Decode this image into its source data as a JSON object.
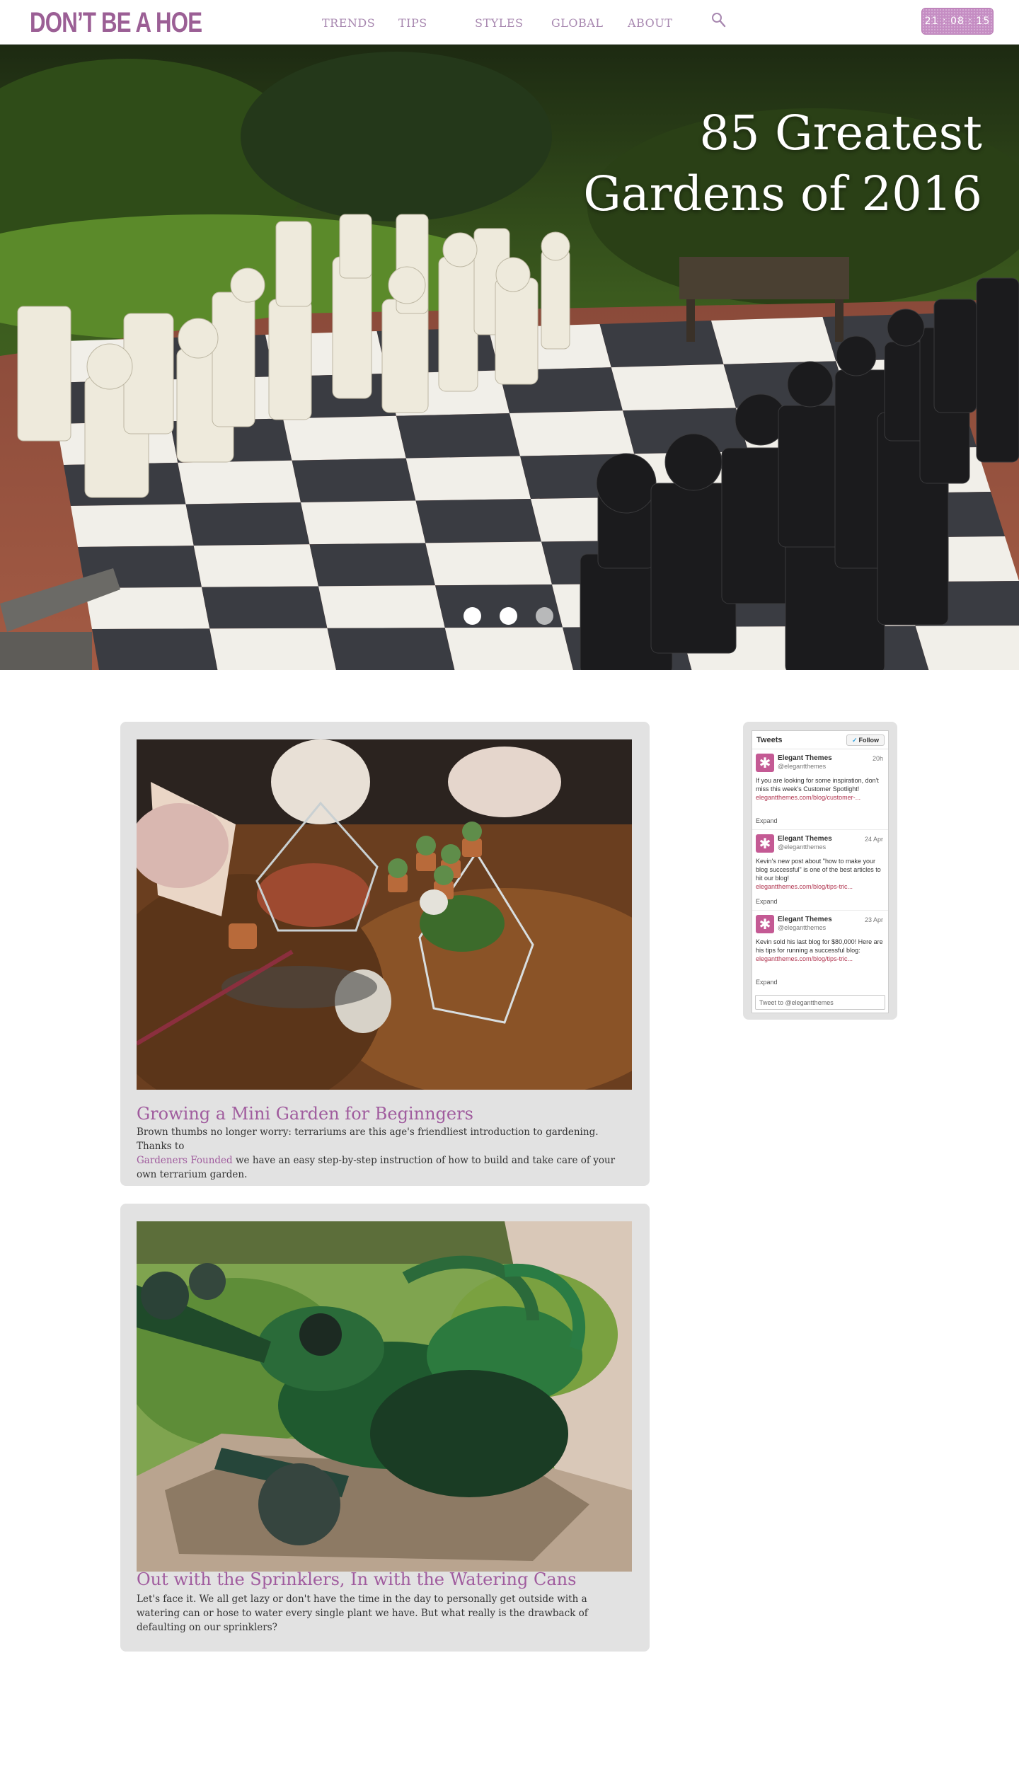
{
  "header": {
    "logo": "DON’T BE A HOE",
    "nav": [
      "TRENDS",
      "TIPS",
      "STYLES",
      "GLOBAL",
      "ABOUT"
    ],
    "search_icon": "search-icon",
    "clock": "21 : 08 : 15"
  },
  "hero": {
    "title_line1": "85 Greatest",
    "title_line2": "Gardens of 2016",
    "slides_total": 3,
    "active_slide": 1
  },
  "posts": [
    {
      "title": "Growing a Mini Garden for Beginngers",
      "body_before": "Brown thumbs no longer worry: terrariums are this age's friendliest introduction to gardening. Thanks to",
      "body_link": "Gardeners Founded",
      "body_after": "we have an easy step-by-step instruction of how to build and take care of your own terrarium garden."
    },
    {
      "title": "Out with the Sprinklers, In with the Watering Cans",
      "body": "Let's face it. We all get lazy or don't have the time in the day to personally get outside with a watering can or hose to water every single plant we have. But what really is the drawback of defaulting on our sprinklers?"
    }
  ],
  "tweets": {
    "heading": "Tweets",
    "follow_label": "Follow",
    "items": [
      {
        "name": "Elegant Themes",
        "handle": "@elegantthemes",
        "time": "20h",
        "text": "If you are looking for some inspiration, don't miss this week's Customer Spotlight!",
        "link": "elegantthemes.com/blog/customer-...",
        "expand": "Expand"
      },
      {
        "name": "Elegant Themes",
        "handle": "@elegantthemes",
        "time": "24 Apr",
        "text": "Kevin's new post about \"how to make your blog successful\" is one of the best articles to hit our blog!",
        "link": "elegantthemes.com/blog/tips-tric...",
        "expand": "Expand"
      },
      {
        "name": "Elegant Themes",
        "handle": "@elegantthemes",
        "time": "23 Apr",
        "text": "Kevin sold his last blog for $80,000! Here are his tips for running a successful blog:",
        "link": "elegantthemes.com/blog/tips-tric...",
        "expand": "Expand"
      }
    ],
    "compose_placeholder": "Tweet to @elegantthemes"
  },
  "colors": {
    "brand": "#9b5f95",
    "nav": "#a888b0",
    "link": "#a05c9e",
    "card_bg": "#e2e2e2"
  }
}
